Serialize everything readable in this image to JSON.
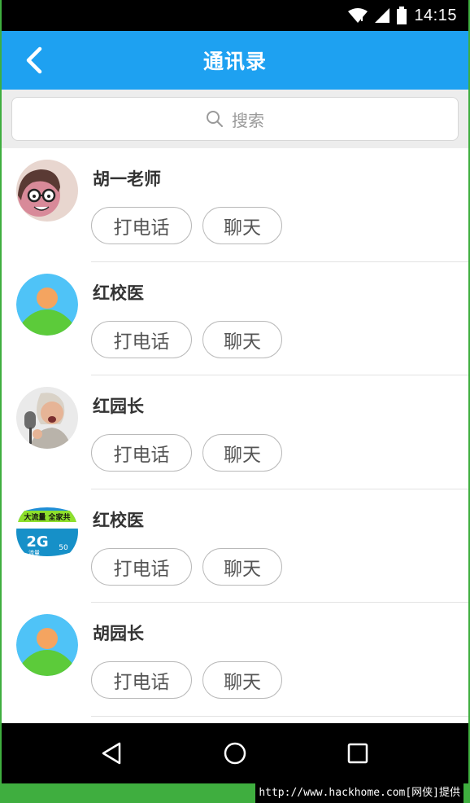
{
  "status": {
    "time": "14:15"
  },
  "header": {
    "title": "通讯录"
  },
  "search": {
    "placeholder": "搜索"
  },
  "contacts": [
    {
      "name": "胡一老师",
      "call_label": "打电话",
      "chat_label": "聊天",
      "avatar": "cartoon-face-avatar"
    },
    {
      "name": "红校医",
      "call_label": "打电话",
      "chat_label": "聊天",
      "avatar": "default-person-avatar"
    },
    {
      "name": "红园长",
      "call_label": "打电话",
      "chat_label": "聊天",
      "avatar": "singer-photo-avatar"
    },
    {
      "name": "红校医",
      "call_label": "打电话",
      "chat_label": "聊天",
      "avatar": "promo-banner-avatar",
      "avatar_text": {
        "line1": "大流量 全家共",
        "line2": "2G",
        "line3": "流量",
        "line4": "50"
      }
    },
    {
      "name": "胡园长",
      "call_label": "打电话",
      "chat_label": "聊天",
      "avatar": "default-person-avatar"
    }
  ],
  "watermark": "http://www.hackhome.com[网侠]提供",
  "colors": {
    "accent": "#1ea1f1",
    "avatar_sky": "#4fc3f7",
    "avatar_head": "#f4a460",
    "avatar_body": "#5ccb3a"
  }
}
